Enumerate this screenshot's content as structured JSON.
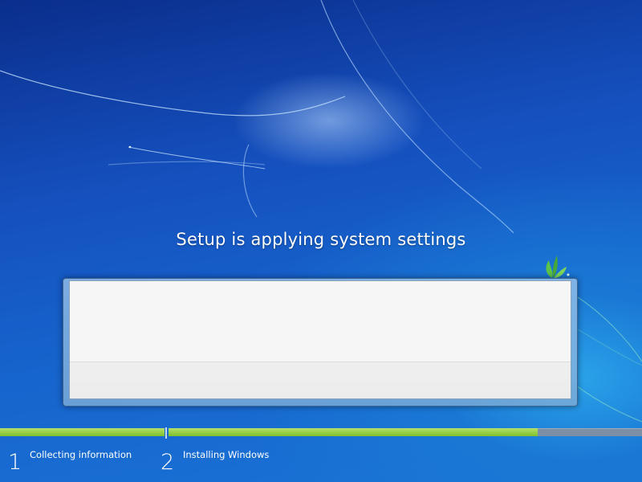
{
  "setup": {
    "title": "Setup is applying system settings"
  },
  "steps": [
    {
      "number": "1",
      "label": "Collecting information"
    },
    {
      "number": "2",
      "label": "Installing Windows"
    }
  ],
  "progress": {
    "step1_fraction": 1.0,
    "step2_fraction": 0.78
  },
  "colors": {
    "progress_green": "#7fbf2c",
    "progress_track": "#7d8fa4",
    "background_blue": "#1550be"
  },
  "icons": {
    "leaf": "windows-leaf-icon"
  }
}
